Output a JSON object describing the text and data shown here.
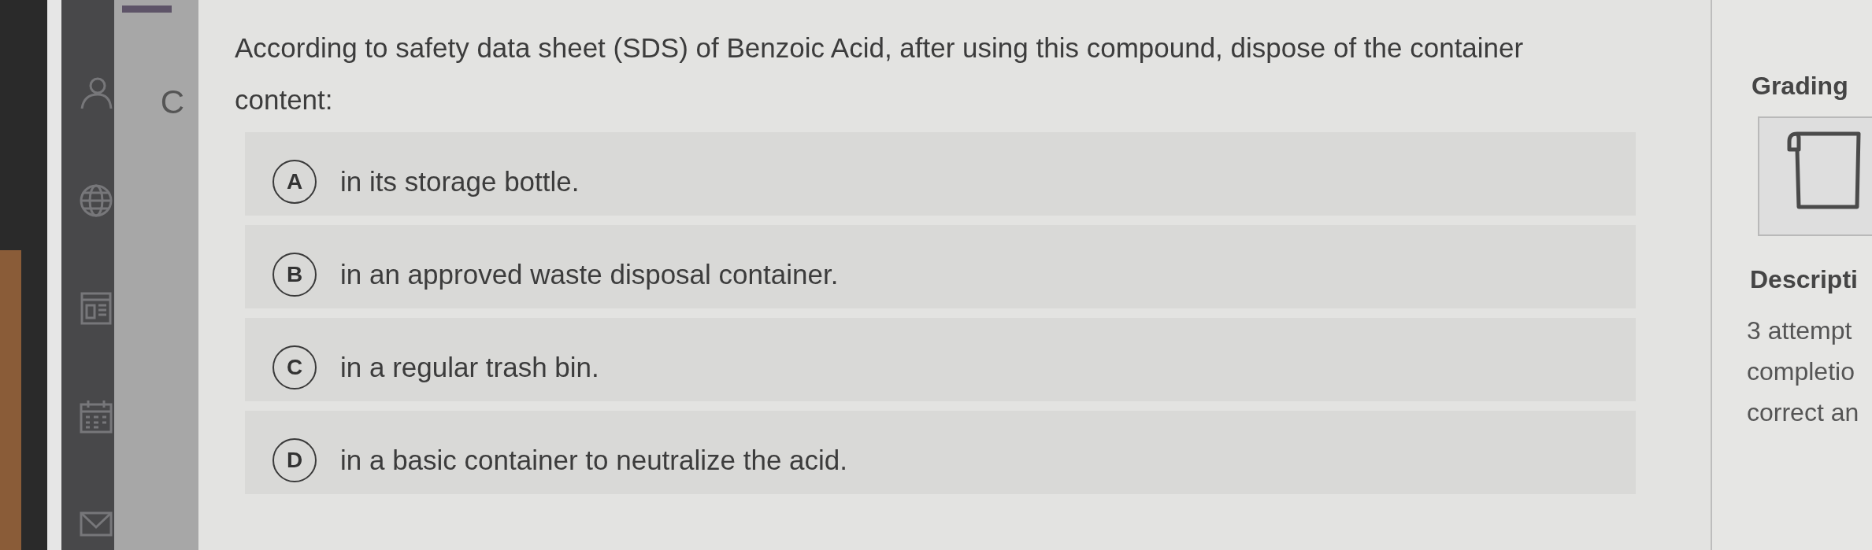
{
  "side_panel": {
    "letter": "C"
  },
  "question": {
    "text": "According to safety data sheet (SDS) of Benzoic Acid, after using this compound, dispose of the container content:",
    "options": [
      {
        "letter": "A",
        "text": "in its storage bottle.",
        "selected": false
      },
      {
        "letter": "B",
        "text": "in an approved waste disposal container.",
        "selected": false
      },
      {
        "letter": "C",
        "text": "in a regular trash bin.",
        "selected": false
      },
      {
        "letter": "D",
        "text": "in a basic container to neutralize the acid.",
        "selected": false
      }
    ]
  },
  "grading_panel": {
    "title": "Grading",
    "description_title": "Descripti",
    "description_lines": [
      "3 attempt",
      "completio",
      "correct an"
    ]
  }
}
